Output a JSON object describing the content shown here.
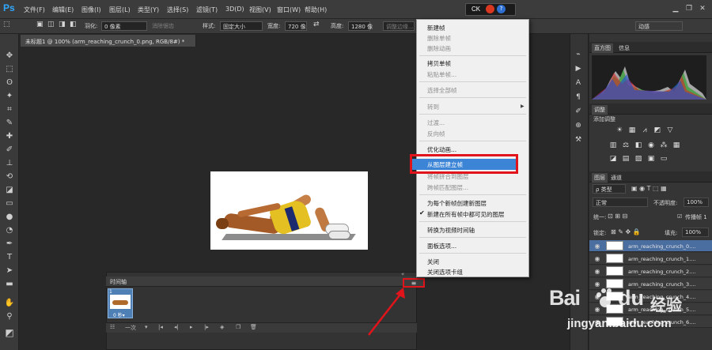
{
  "app": {
    "logo": "Ps",
    "menus": [
      "文件(F)",
      "编辑(E)",
      "图像(I)",
      "图层(L)",
      "类型(Y)",
      "选择(S)",
      "滤镜(T)",
      "3D(D)",
      "视图(V)",
      "窗口(W)",
      "帮助(H)"
    ],
    "status_box": "CK"
  },
  "options": {
    "feather_label": "羽化:",
    "feather_value": "0 像素",
    "antialias": "消除锯齿",
    "style_label": "样式:",
    "style_value": "固定大小",
    "width_label": "宽度:",
    "width_value": "720 像",
    "height_label": "高度:",
    "height_value": "1280 像",
    "refine_edge": "调整边缘...",
    "workspace": "动感"
  },
  "document": {
    "tab_title": "未标题1 @ 100% (arm_reaching_crunch_0.png, RGB/8#) *"
  },
  "timeline": {
    "title": "时间轴",
    "frame_number": "1",
    "frame_delay": "0 秒▾",
    "loop": "一次",
    "menu_icon": "≡"
  },
  "context_menu": {
    "items": [
      {
        "label": "新建帧",
        "enabled": true
      },
      {
        "label": "删除单帧",
        "enabled": false
      },
      {
        "label": "删除动画",
        "enabled": false
      },
      {
        "label": "拷贝单帧",
        "enabled": true
      },
      {
        "label": "粘贴单帧...",
        "enabled": false
      },
      {
        "label": "选择全部帧",
        "enabled": false
      },
      {
        "label": "转到",
        "enabled": false
      },
      {
        "label": "过渡...",
        "enabled": false
      },
      {
        "label": "反向帧",
        "enabled": false
      },
      {
        "label": "优化动画...",
        "enabled": true
      },
      {
        "label": "从图层建立帧",
        "enabled": true,
        "highlighted": true
      },
      {
        "label": "将帧拼合到图层",
        "enabled": false
      },
      {
        "label": "跨帧匹配图层...",
        "enabled": false
      },
      {
        "label": "为每个新帧创建新图层",
        "enabled": true
      },
      {
        "label": "新建在所有帧中都可见的图层",
        "enabled": true,
        "checked": true
      },
      {
        "label": "转换为视频时间轴",
        "enabled": true
      },
      {
        "label": "面板选项...",
        "enabled": true
      },
      {
        "label": "关闭",
        "enabled": true
      },
      {
        "label": "关闭选项卡组",
        "enabled": true
      }
    ]
  },
  "right_panels": {
    "histogram_tabs": [
      "直方图",
      "信息"
    ],
    "adjustments_tab": "调整",
    "adjustments_label": "添加调整",
    "layers_tabs": [
      "图层",
      "通道"
    ],
    "kind_filter": "ρ 类型",
    "blend_mode": "正常",
    "opacity_label": "不透明度:",
    "opacity_value": "100%",
    "unify_label": "统一:",
    "propagate_label": "传播帧 1",
    "lock_label": "锁定:",
    "fill_label": "填充:",
    "fill_value": "100%",
    "layers": [
      "arm_reaching_crunch_0....",
      "arm_reaching_crunch_1....",
      "arm_reaching_crunch_2....",
      "arm_reaching_crunch_3....",
      "arm_reaching_crunch_4....",
      "arm_reaching_crunch_5....",
      "arm_reaching_crunch_6...."
    ]
  },
  "watermark": {
    "bai": "Bai",
    "du": "du",
    "jingyan": "经验",
    "url": "jingyan.baidu.com"
  },
  "colors": {
    "highlight_red": "#e0141a",
    "menu_highlight": "#3c84d6",
    "ps_blue": "#31a8ff"
  }
}
